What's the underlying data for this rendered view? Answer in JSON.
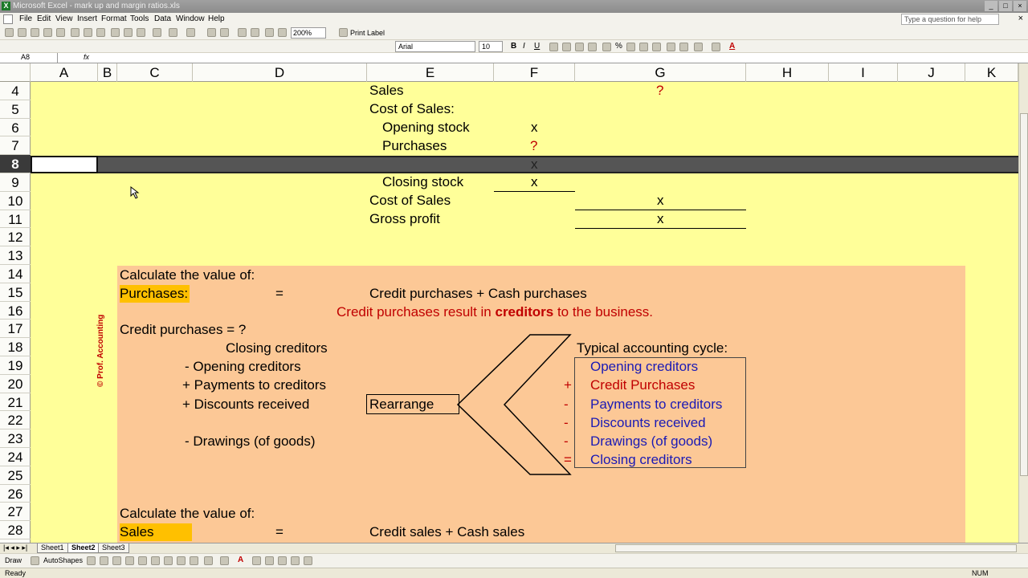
{
  "window": {
    "title": "Microsoft Excel - mark up and margin ratios.xls"
  },
  "menu": [
    "File",
    "Edit",
    "View",
    "Insert",
    "Format",
    "Tools",
    "Data",
    "Window",
    "Help"
  ],
  "help_placeholder": "Type a question for help",
  "toolbar": {
    "zoom": "200%",
    "print_label": "Print Label"
  },
  "format_bar": {
    "font": "Arial",
    "size": "10"
  },
  "name_box": "A8",
  "fx": "fx",
  "columns": [
    "A",
    "B",
    "C",
    "D",
    "E",
    "F",
    "G",
    "H",
    "I",
    "J",
    "K"
  ],
  "rows": [
    "4",
    "5",
    "6",
    "7",
    "8",
    "9",
    "10",
    "11",
    "12",
    "13",
    "14",
    "15",
    "16",
    "17",
    "18",
    "19",
    "20",
    "21",
    "22",
    "23",
    "24",
    "25",
    "26",
    "27",
    "28"
  ],
  "income": {
    "sales": "Sales",
    "q_sales": "?",
    "cost_of_sales": "Cost of Sales:",
    "opening_stock": "Opening stock",
    "x1": "x",
    "purchases": "Purchases",
    "q_purchases": "?",
    "x_row8": "x",
    "closing_stock": "Closing stock",
    "x2": "x",
    "cost_of_sales2": "Cost of Sales",
    "x3": "x",
    "gross_profit": "Gross profit",
    "x4": "x"
  },
  "block": {
    "calc1": "Calculate the value of:",
    "purchases_label": "Purchases:",
    "eq1": "=",
    "purchases_formula": "Credit purchases + Cash purchases",
    "note_pre": "Credit purchases result in ",
    "note_bold": "creditors",
    "note_post": " to the business.",
    "credit_q": "Credit purchases = ?",
    "closing_creditors": "Closing creditors",
    "opening_creditors": "- Opening creditors",
    "payments": "+ Payments to creditors",
    "discounts": "+ Discounts received",
    "drawings": "- Drawings (of goods)",
    "rearrange": "Rearrange",
    "cycle_title": "Typical accounting cycle:",
    "calc2": "Calculate the value of:",
    "sales_label": "Sales",
    "eq2": "=",
    "sales_formula": "Credit sales + Cash sales",
    "watermark": "© Prof. Accounting"
  },
  "cycle": [
    {
      "sign": "",
      "text": "Opening creditors",
      "color": "#1a1ab5"
    },
    {
      "sign": "+",
      "text": "Credit Purchases",
      "color": "#c00000"
    },
    {
      "sign": "-",
      "text": "Payments to creditors",
      "color": "#1a1ab5"
    },
    {
      "sign": "-",
      "text": "Discounts received",
      "color": "#1a1ab5"
    },
    {
      "sign": "-",
      "text": "Drawings (of goods)",
      "color": "#1a1ab5"
    },
    {
      "sign": "=",
      "text": "Closing creditors",
      "color": "#1a1ab5"
    }
  ],
  "sheets": [
    "Sheet1",
    "Sheet2",
    "Sheet3"
  ],
  "active_sheet": "Sheet2",
  "drawbar": {
    "draw": "Draw",
    "autoshapes": "AutoShapes"
  },
  "status": {
    "left": "Ready",
    "right": "NUM"
  }
}
